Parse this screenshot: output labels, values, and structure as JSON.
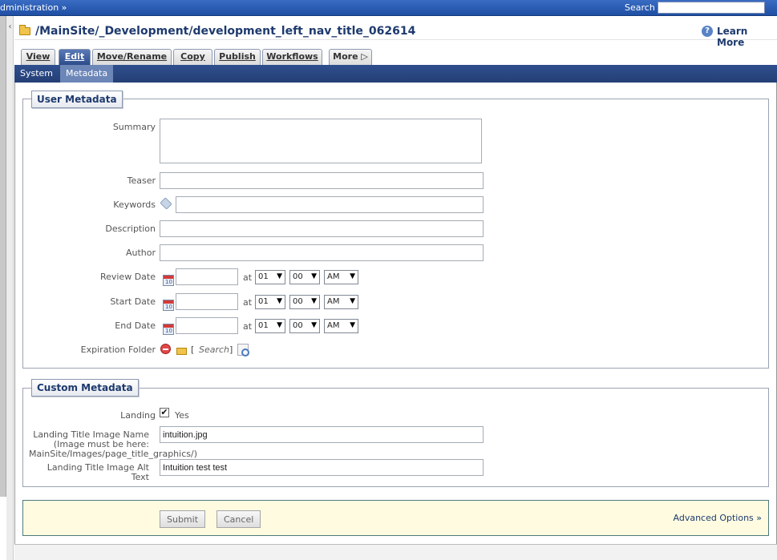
{
  "topbar": {
    "admin_label": "dministration »",
    "search_label": "Search",
    "search_value": ""
  },
  "path": {
    "title": "/MainSite/_Development/development_left_nav_title_062614",
    "learn_more": "Learn More"
  },
  "tabs": [
    {
      "label": "View"
    },
    {
      "label": "Edit"
    },
    {
      "label": "Move/Rename"
    },
    {
      "label": "Copy"
    },
    {
      "label": "Publish"
    },
    {
      "label": "Workflows"
    },
    {
      "label": "More ▷"
    }
  ],
  "subtabs": [
    {
      "label": "System"
    },
    {
      "label": "Metadata"
    }
  ],
  "user_metadata": {
    "legend": "User Metadata",
    "summary_label": "Summary",
    "teaser_label": "Teaser",
    "keywords_label": "Keywords",
    "description_label": "Description",
    "author_label": "Author",
    "review_label": "Review Date",
    "start_label": "Start Date",
    "end_label": "End Date",
    "at": "at",
    "hour": "01",
    "minute": "00",
    "ampm": "AM",
    "expiration_label": "Expiration Folder",
    "bracket_open": "[",
    "search_text": "Search",
    "bracket_close": "]"
  },
  "custom_metadata": {
    "legend": "Custom Metadata",
    "landing_label": "Landing",
    "landing_checked": "✔",
    "landing_yes": "Yes",
    "image_name_label_1": "Landing Title Image Name",
    "image_name_label_2": "(Image must be here:",
    "image_name_label_3": "MainSite/Images/page_title_graphics/)",
    "image_name_value": "intuition.jpg",
    "alt_label_1": "Landing Title Image Alt",
    "alt_label_2": "Text",
    "alt_value": "Intuition test test"
  },
  "actions": {
    "submit": "Submit",
    "cancel": "Cancel",
    "advanced": "Advanced Options »"
  }
}
